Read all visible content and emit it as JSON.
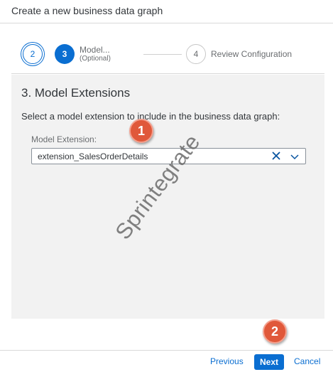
{
  "dialog": {
    "title": "Create a new business data graph"
  },
  "wizard": {
    "steps": [
      {
        "number": "2"
      },
      {
        "number": "3",
        "label": "Model...",
        "sublabel": "(Optional)"
      },
      {
        "number": "4",
        "label": "Review Configuration"
      }
    ]
  },
  "content": {
    "section_title": "3. Model Extensions",
    "instruction": "Select a model extension to include in the business data graph:",
    "field": {
      "label": "Model Extension:",
      "value": "extension_SalesOrderDetails"
    }
  },
  "annotations": {
    "marker_1": "1",
    "marker_2": "2"
  },
  "watermark": "Sprintegrate",
  "footer": {
    "previous_label": "Previous",
    "next_label": "Next",
    "cancel_label": "Cancel"
  },
  "colors": {
    "accent": "#0a6ed1",
    "marker": "#e0583a",
    "panel": "#f2f2f2"
  },
  "icons": {
    "clear": "close-icon",
    "dropdown": "chevron-down-icon"
  }
}
